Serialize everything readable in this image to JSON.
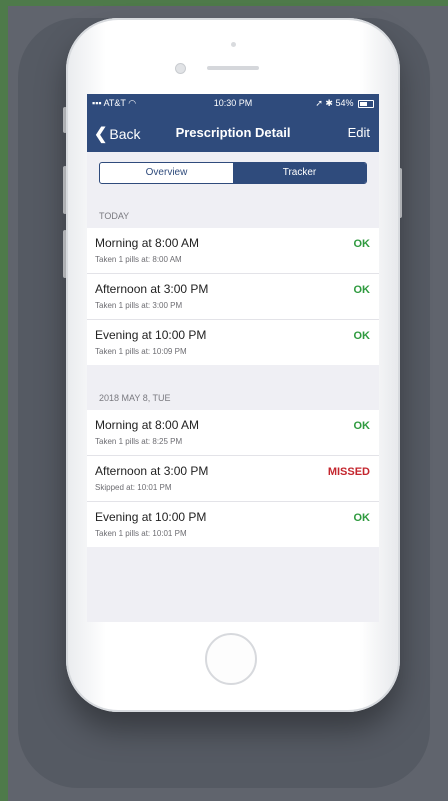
{
  "status_bar": {
    "carrier": "AT&T",
    "time": "10:30 PM",
    "battery": "54%"
  },
  "nav": {
    "back_label": "Back",
    "title": "Prescription Detail",
    "edit_label": "Edit"
  },
  "segments": {
    "overview": "Overview",
    "tracker": "Tracker",
    "selected": "Tracker"
  },
  "colors": {
    "ok": "#2e9a3e",
    "missed": "#c4262e",
    "header": "#2f4b7c"
  },
  "sections": [
    {
      "header": "TODAY",
      "items": [
        {
          "name": "Morning at 8:00 AM",
          "detail": "Taken 1 pills at: 8:00 AM",
          "status": "OK"
        },
        {
          "name": "Afternoon at 3:00 PM",
          "detail": "Taken 1 pills at: 3:00 PM",
          "status": "OK"
        },
        {
          "name": "Evening at 10:00 PM",
          "detail": "Taken 1 pills at: 10:09 PM",
          "status": "OK"
        }
      ]
    },
    {
      "header": "2018 MAY 8, TUE",
      "items": [
        {
          "name": "Morning at 8:00 AM",
          "detail": "Taken 1 pills at: 8:25 PM",
          "status": "OK"
        },
        {
          "name": "Afternoon at 3:00 PM",
          "detail": "Skipped at: 10:01 PM",
          "status": "MISSED"
        },
        {
          "name": "Evening at 10:00 PM",
          "detail": "Taken 1 pills at: 10:01 PM",
          "status": "OK"
        }
      ]
    }
  ]
}
